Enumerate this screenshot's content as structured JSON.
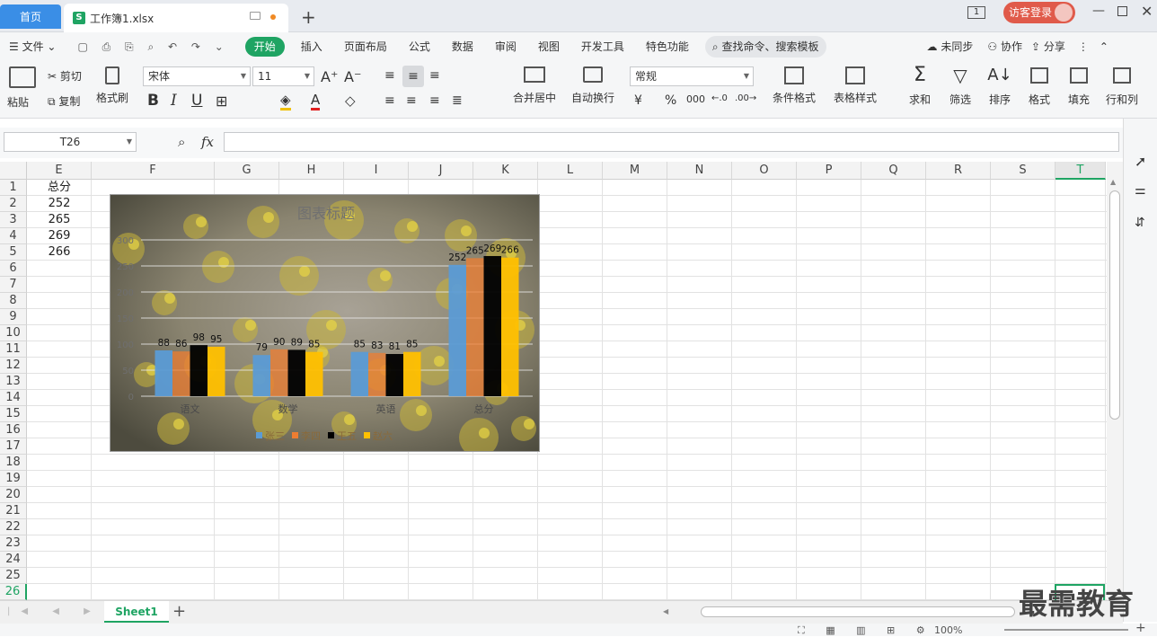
{
  "titlebar": {
    "home_tab": "首页",
    "file_tab": "工作簿1.xlsx",
    "file_icon": "S",
    "badge": "1",
    "login": "访客登录"
  },
  "menubar": {
    "file": "文件",
    "items": [
      "开始",
      "插入",
      "页面布局",
      "公式",
      "数据",
      "审阅",
      "视图",
      "开发工具",
      "特色功能"
    ],
    "search": "查找命令、搜索模板",
    "sync": "未同步",
    "collab": "协作",
    "share": "分享"
  },
  "ribbon": {
    "paste": "粘贴",
    "cut": "剪切",
    "copy": "复制",
    "format_painter": "格式刷",
    "font_name": "宋体",
    "font_size": "11",
    "merge_center": "合并居中",
    "auto_wrap": "自动换行",
    "number_format": "常规",
    "conditional_format": "条件格式",
    "table_style": "表格样式",
    "sum": "求和",
    "filter": "筛选",
    "sort": "排序",
    "format": "格式",
    "fill": "填充",
    "rows_cols": "行和列"
  },
  "formula": {
    "name_box": "T26",
    "fx": "fx",
    "value": ""
  },
  "columns": [
    "E",
    "F",
    "G",
    "H",
    "I",
    "J",
    "K",
    "L",
    "M",
    "N",
    "O",
    "P",
    "Q",
    "R",
    "S",
    "T"
  ],
  "rows": [
    "1",
    "2",
    "3",
    "4",
    "5",
    "6",
    "7",
    "8",
    "9",
    "10",
    "11",
    "12",
    "13",
    "14",
    "15",
    "16",
    "17",
    "18",
    "19",
    "20",
    "21",
    "22",
    "23",
    "24",
    "25",
    "26"
  ],
  "cells": {
    "E1": "总分",
    "E2": "252",
    "E3": "265",
    "E4": "269",
    "E5": "266"
  },
  "chart_data": {
    "type": "bar",
    "title": "图表标题",
    "categories": [
      "语文",
      "数学",
      "英语",
      "总分"
    ],
    "series": [
      {
        "name": "张三",
        "color": "#5b9bd5",
        "values": [
          88,
          79,
          85,
          252
        ]
      },
      {
        "name": "李四",
        "color": "#ed7d31",
        "values": [
          86,
          90,
          83,
          265
        ]
      },
      {
        "name": "王五",
        "color": "#000000",
        "values": [
          98,
          89,
          81,
          269
        ]
      },
      {
        "name": "赵六",
        "color": "#ffc000",
        "values": [
          95,
          85,
          85,
          266
        ]
      }
    ],
    "ylim": [
      0,
      300
    ],
    "yticks": [
      "0",
      "50",
      "100",
      "150",
      "200",
      "250",
      "300"
    ],
    "legend_placement": "bottom",
    "grid": true
  },
  "sheet_tabs": [
    "Sheet1"
  ],
  "status": {
    "zoom": "100%"
  },
  "watermark": "最需教育"
}
